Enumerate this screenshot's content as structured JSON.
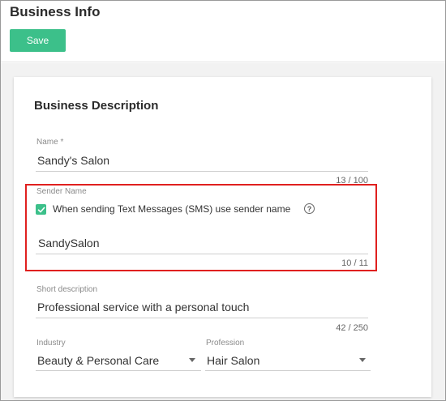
{
  "header": {
    "title": "Business Info",
    "save_label": "Save"
  },
  "colors": {
    "accent": "#3cc08a",
    "highlight": "#e0201f"
  },
  "section": {
    "title": "Business Description"
  },
  "name_field": {
    "label": "Name *",
    "value": "Sandy's Salon",
    "counter": "13 / 100"
  },
  "sender_name": {
    "label": "Sender Name",
    "checkbox_label": "When sending Text Messages (SMS) use sender name",
    "checked": true,
    "help_icon": "?",
    "value": "SandySalon",
    "counter": "10 / 11"
  },
  "short_description": {
    "label": "Short description",
    "value": "Professional service with a personal touch",
    "counter": "42 / 250"
  },
  "industry": {
    "label": "Industry",
    "value": "Beauty & Personal Care"
  },
  "profession": {
    "label": "Profession",
    "value": "Hair Salon"
  }
}
